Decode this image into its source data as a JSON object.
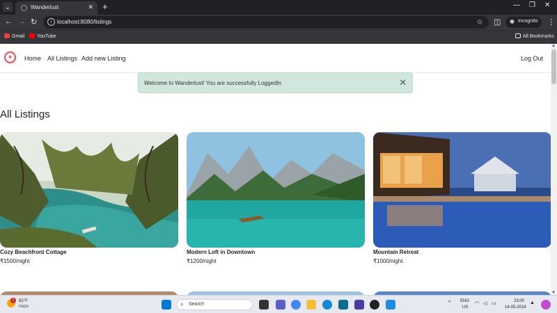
{
  "browser": {
    "tab_title": "Wanderlust",
    "url": "localhost:8080/listings",
    "incognito_label": "Incognito",
    "bookmarks": [
      {
        "label": "Gmail"
      },
      {
        "label": "YouTube"
      }
    ],
    "all_bookmarks_label": "All Bookmarks"
  },
  "app": {
    "nav": {
      "home": "Home",
      "all_listings": "All Listings",
      "add_new": "Add new Listing",
      "logout": "Log Out"
    },
    "flash": "Welcome to Wanderlust! You are successfully LoggedIn",
    "heading": "All Listings",
    "listings": [
      {
        "title": "Cozy Beachfront Cottage",
        "price": "₹1500/night"
      },
      {
        "title": "Modern Loft in Downtown",
        "price": "₹1200/night"
      },
      {
        "title": "Mountain Retreat",
        "price": "₹1000/night"
      }
    ],
    "accent_color": "#fe424d"
  },
  "taskbar": {
    "weather_temp": "82°F",
    "weather_desc": "Haze",
    "weather_badge": "1",
    "search_label": "Search",
    "lang_line1": "ENG",
    "lang_line2": "US",
    "time": "23:00",
    "date": "14-05-2024"
  }
}
